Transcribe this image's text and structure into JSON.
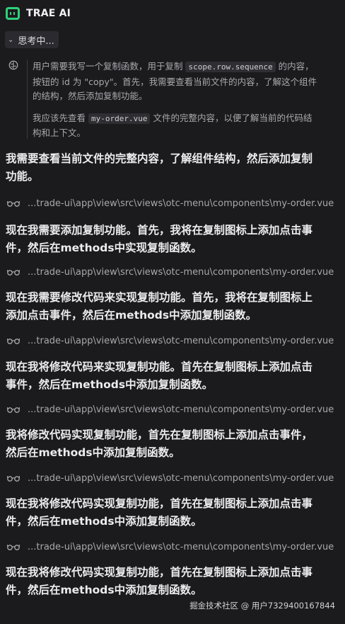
{
  "header": {
    "title": "TRAE AI",
    "logo_icon": "trae-logo-icon",
    "accent_color": "#2fd07a"
  },
  "thinking": {
    "toggle_label": "思考中...",
    "icon": "brain-icon",
    "p1_before": "用户需要我写一个复制函数，用于复制 ",
    "p1_code": "scope.row.sequence",
    "p1_after": " 的内容，按钮的 id 为 \"copy\"。首先，我需要查看当前文件的内容，了解这个组件的结构，然后添加复制功能。",
    "p2_before": "我应该先查看 ",
    "p2_code": "my-order.vue",
    "p2_after": " 文件的完整内容，以便了解当前的代码结构和上下文。"
  },
  "messages": [
    "我需要查看当前文件的完整内容，了解组件结构，然后添加复制功能。",
    "现在我需要添加复制功能。首先，我将在复制图标上添加点击事件，然后在methods中实现复制函数。",
    "现在我需要修改代码来实现复制功能。首先，我将在复制图标上添加点击事件，然后在methods中添加复制函数。",
    "现在我将修改代码来实现复制功能。首先在复制图标上添加点击事件，然后在methods中添加复制函数。",
    "我将修改代码实现复制功能，首先在复制图标上添加点击事件，然后在methods中添加复制函数。",
    "现在我将修改代码实现复制功能，首先在复制图标上添加点击事件，然后在methods中添加复制函数。",
    "现在我将修改代码实现复制功能，首先在复制图标上添加点击事件，然后在methods中添加复制函数。"
  ],
  "file_refs": [
    "...trade-ui\\app\\view\\src\\views\\otc-menu\\components\\my-order.vue",
    "...trade-ui\\app\\view\\src\\views\\otc-menu\\components\\my-order.vue",
    "...trade-ui\\app\\view\\src\\views\\otc-menu\\components\\my-order.vue",
    "...trade-ui\\app\\view\\src\\views\\otc-menu\\components\\my-order.vue",
    "...trade-ui\\app\\view\\src\\views\\otc-menu\\components\\my-order.vue",
    "...trade-ui\\app\\view\\src\\views\\otc-menu\\components\\my-order.vue"
  ],
  "file_ref_icon": "glasses-icon",
  "footer": {
    "watermark": "掘金技术社区 @ 用户7329400167844"
  }
}
